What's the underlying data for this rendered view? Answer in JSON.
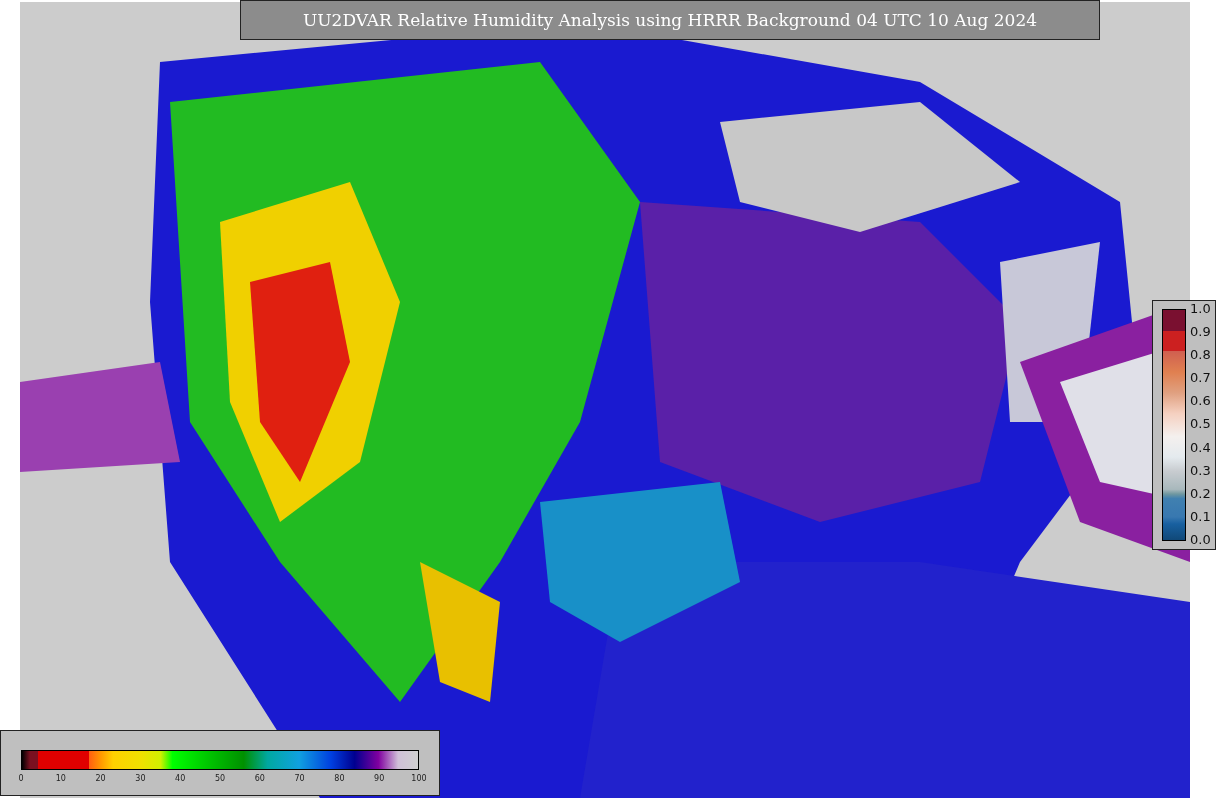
{
  "map": {
    "title": "UU2DVAR Relative Humidity Analysis using HRRR Background 04 UTC 10 Aug 2024",
    "kind": "picture"
  },
  "humidity_legend": {
    "ticks": [
      "0",
      "10",
      "20",
      "30",
      "40",
      "50",
      "60",
      "70",
      "80",
      "90",
      "100"
    ]
  },
  "ratio_legend": {
    "ticks": [
      "1.0",
      "0.9",
      "0.8",
      "0.7",
      "0.6",
      "0.5",
      "0.4",
      "0.3",
      "0.2",
      "0.1",
      "0.0"
    ]
  }
}
